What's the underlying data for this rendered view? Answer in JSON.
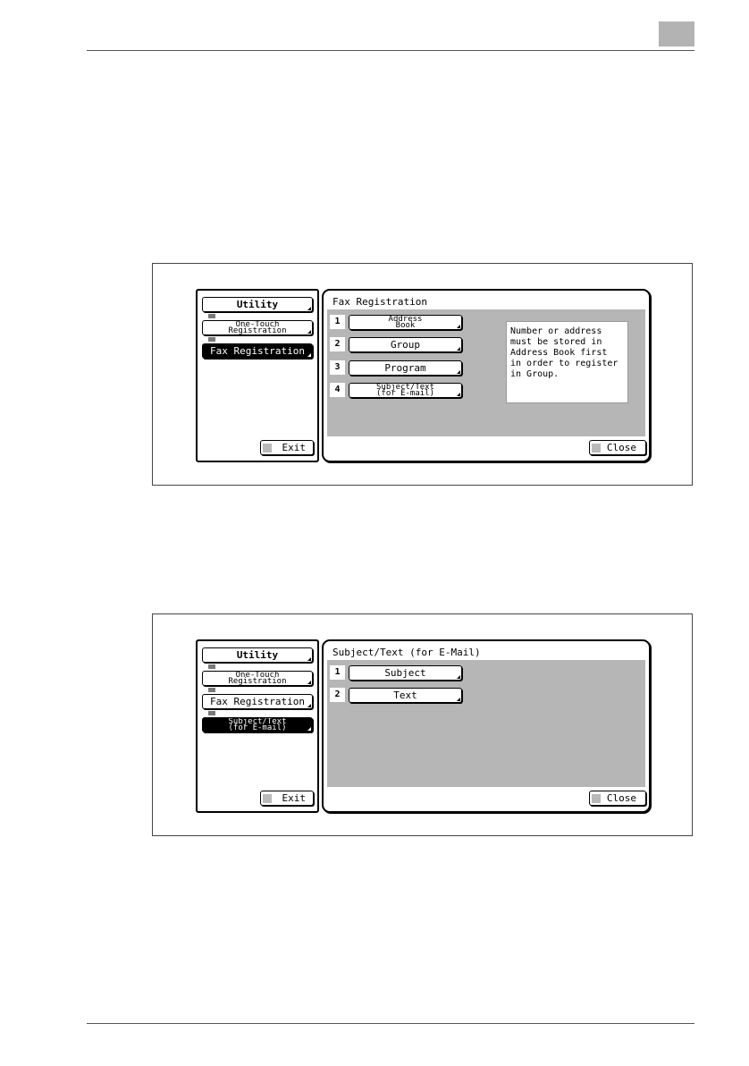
{
  "screen1": {
    "left_nav": [
      {
        "label": "Utility",
        "selected": false
      },
      {
        "label": "One-Touch\nRegistration",
        "selected": false
      },
      {
        "label": "Fax Registration",
        "selected": true
      }
    ],
    "exit_label": "Exit",
    "title": "Fax Registration",
    "options": [
      {
        "num": "1",
        "label": "Address\nBook"
      },
      {
        "num": "2",
        "label": "Group"
      },
      {
        "num": "3",
        "label": "Program"
      },
      {
        "num": "4",
        "label": "Subject/Text\n(for E-mail)"
      }
    ],
    "message": "Number or address\nmust be stored in\nAddress Book first\nin order to register\nin Group.",
    "close_label": "Close"
  },
  "screen2": {
    "left_nav": [
      {
        "label": "Utility",
        "selected": false
      },
      {
        "label": "One-Touch\nRegistration",
        "selected": false
      },
      {
        "label": "Fax Registration",
        "selected": false
      },
      {
        "label": "Subject/Text\n(for E-mail)",
        "selected": true
      }
    ],
    "exit_label": "Exit",
    "title": "Subject/Text (for E-Mail)",
    "options": [
      {
        "num": "1",
        "label": "Subject"
      },
      {
        "num": "2",
        "label": "Text"
      }
    ],
    "close_label": "Close"
  }
}
